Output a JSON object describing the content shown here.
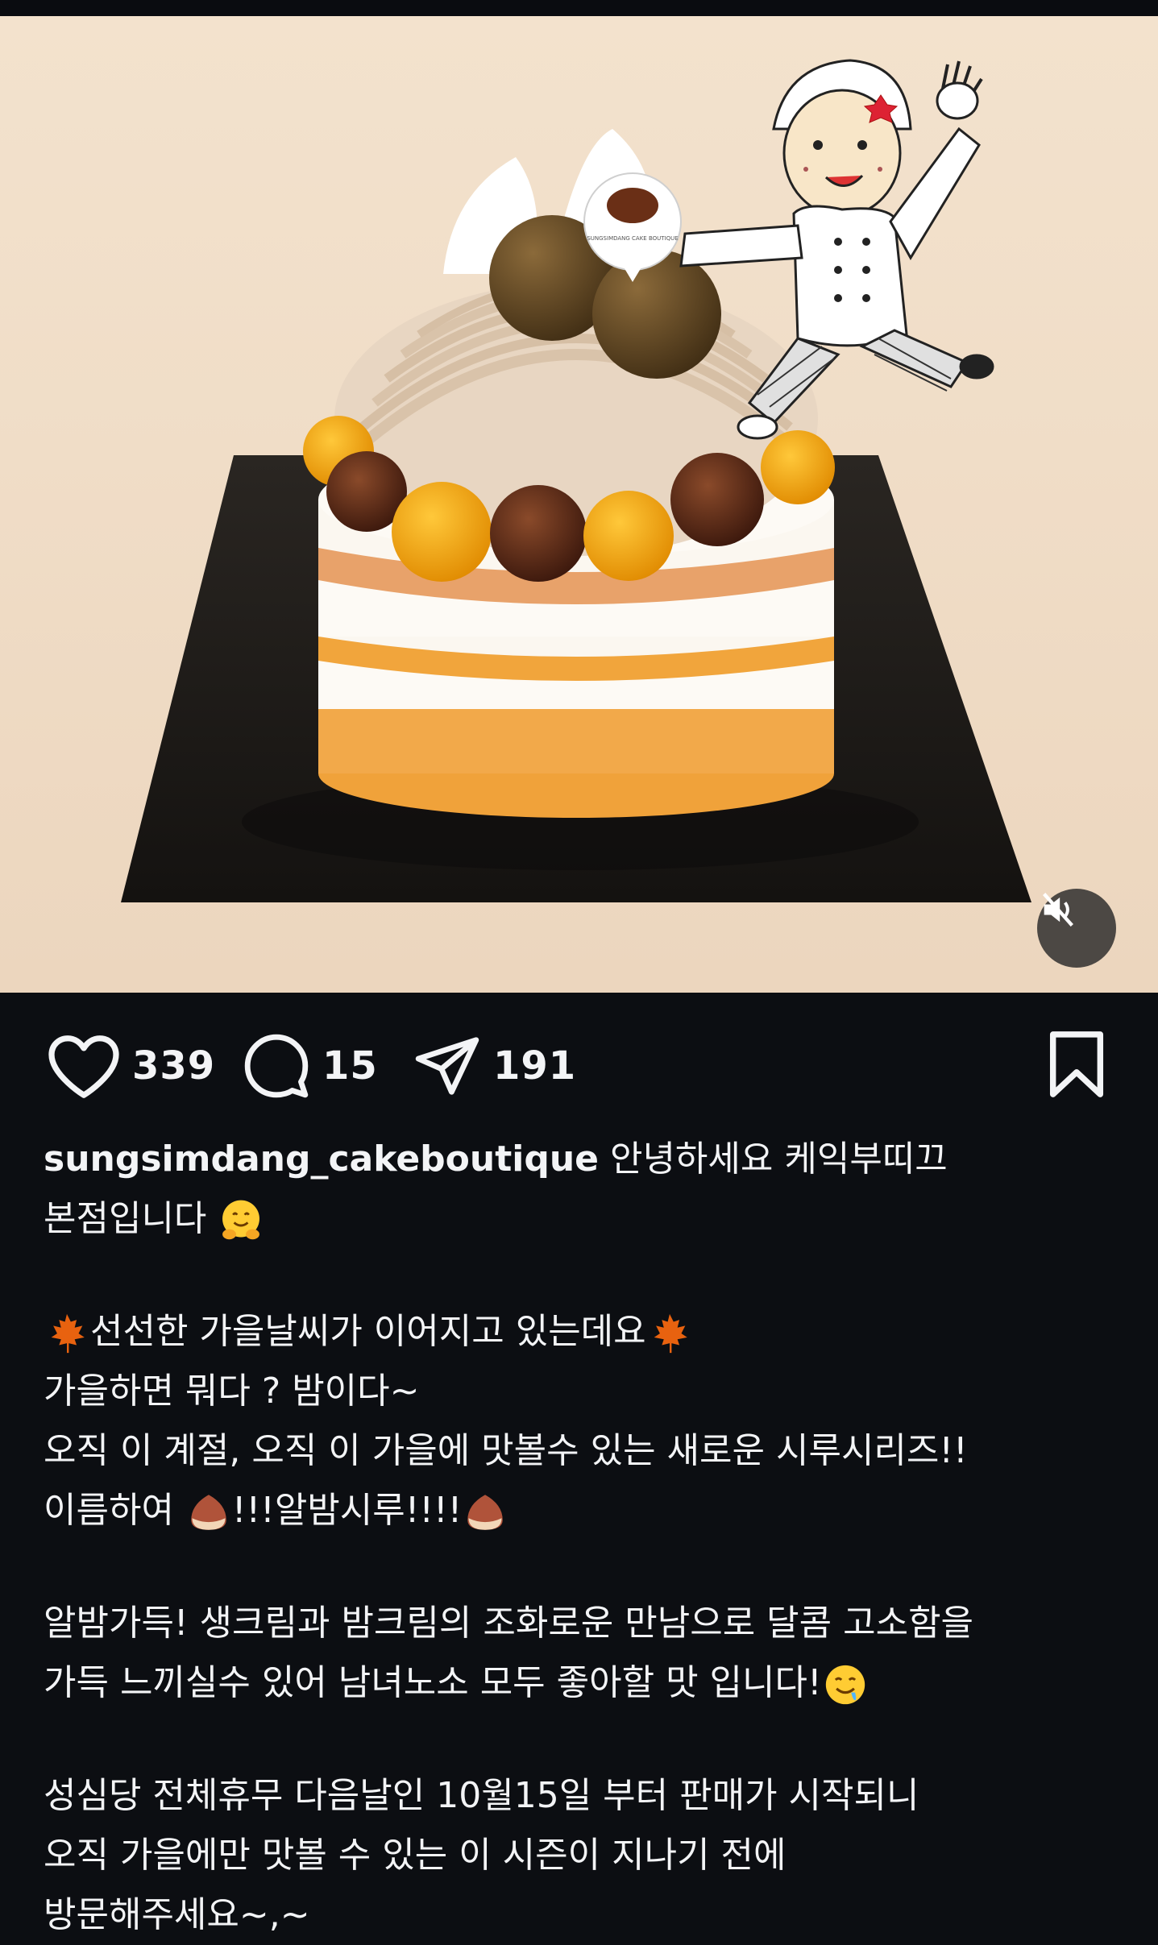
{
  "post": {
    "username": "sungsimdang_cakeboutique",
    "likes": "339",
    "comments": "15",
    "shares": "191"
  },
  "media": {
    "sign_text": "SUNGSIMDANG CAKE BOUTIQUE",
    "muted": true
  },
  "caption": {
    "line1_text": " 안녕하세요 케익부띠끄",
    "line2_text": "본점입니다",
    "line3_text": "선선한 가을날씨가 이어지고 있는데요",
    "line4_text": "가을하면 뭐다 ? 밤이다~",
    "line5_text": "오직 이 계절, 오직 이 가을에 맛볼수 있는 새로운 시루시리즈!!",
    "line6_a": "이름하여 ",
    "line6_b": "!!!알밤시루!!!!",
    "line7_text": "알밤가득! 생크림과 밤크림의  조화로운 만남으로  달콤 고소함을",
    "line8_text": "가득 느끼실수 있어 남녀노소 모두 좋아할 맛 입니다!",
    "line9_text": "성심당 전체휴무 다음날인 10월15일 부터 판매가 시작되니",
    "line10_text": "오직 가을에만 맛볼 수 있는  이 시즌이 지나기 전에",
    "line11_text": "방문해주세요~,~"
  },
  "icons": {
    "like": "heart-icon",
    "comment": "comment-bubble-icon",
    "share": "paper-plane-icon",
    "save": "bookmark-icon",
    "mute": "speaker-muted-icon"
  },
  "colors": {
    "background": "#0c0e12",
    "text": "#f3f4f6",
    "media_bg": "#f0ddc7"
  }
}
